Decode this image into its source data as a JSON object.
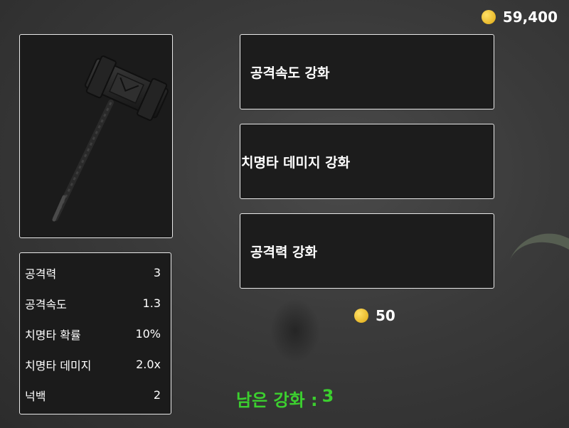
{
  "currency": {
    "amount": "59,400",
    "icon": "coin-icon",
    "coin_color": "#f0c53a"
  },
  "weapon": {
    "name_icon": "hammer-icon"
  },
  "stats": [
    {
      "label": "공격력",
      "value": "3"
    },
    {
      "label": "공격속도",
      "value": "1.3"
    },
    {
      "label": "치명타 확률",
      "value": "10%"
    },
    {
      "label": "치명타 데미지",
      "value": "2.0x"
    },
    {
      "label": "넉백",
      "value": "2"
    }
  ],
  "upgrades": [
    {
      "label": "공격속도 강화"
    },
    {
      "label": "치명타 데미지 강화"
    },
    {
      "label": "공격력 강화"
    }
  ],
  "cost": {
    "amount": "50",
    "icon": "coin-icon"
  },
  "remaining": {
    "label": "남은 강화 :",
    "value": "3",
    "color": "#3ccf2f"
  }
}
